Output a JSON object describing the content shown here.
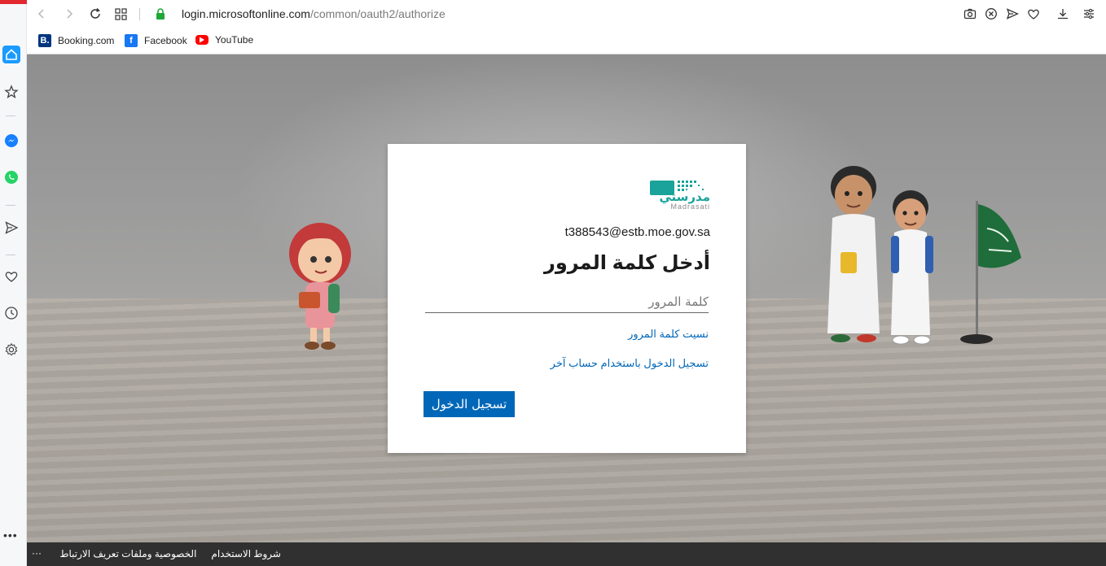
{
  "browser": {
    "url_host": "login.microsoftonline.com",
    "url_path": "/common/oauth2/authorize",
    "bookmarks": [
      {
        "label": "Booking.com",
        "icon": "booking-icon",
        "color": "#003580"
      },
      {
        "label": "Facebook",
        "icon": "facebook-icon",
        "color": "#1877f2"
      },
      {
        "label": "YouTube",
        "icon": "youtube-icon",
        "color": "#ff0000"
      }
    ],
    "accent": "#1a9bff"
  },
  "login": {
    "brand_arabic": "مدرستي",
    "brand_latin": "Madrasati",
    "email": "t388543@estb.moe.gov.sa",
    "title": "أدخل كلمة المرور",
    "password_placeholder": "كلمة المرور",
    "forgot_password": "نسيت كلمة المرور",
    "other_account": "تسجيل الدخول باستخدام حساب آخر",
    "signin_button": "تسجيل الدخول",
    "brand_color": "#1aa39a",
    "button_color": "#0067b8"
  },
  "footer": {
    "terms": "شروط الاستخدام",
    "privacy": "الخصوصية وملفات تعريف الارتباط",
    "more": "···"
  }
}
